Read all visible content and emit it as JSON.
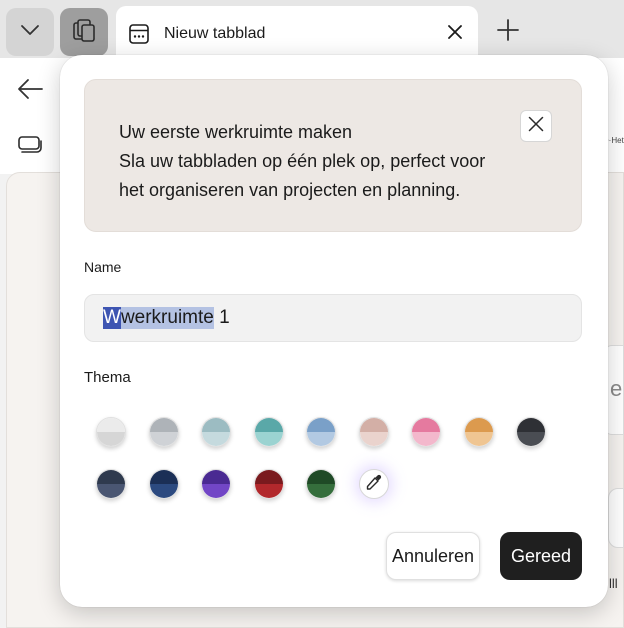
{
  "browser": {
    "tab": {
      "title": "Nieuw tabblad",
      "icon": "new-tab-page-icon"
    },
    "background_fragment": "~·Het",
    "background_char": "e",
    "background_bars": "lll"
  },
  "dialog": {
    "banner": {
      "title": "Uw eerste werkruimte maken",
      "line2": "Sla uw tabbladen op één plek op, perfect voor",
      "line3": "het organiseren van projecten en planning."
    },
    "name_label": "Name",
    "name_value": {
      "part_a": "W",
      "part_b": "werkruimte",
      "part_c": " 1"
    },
    "theme_label": "Thema",
    "themes": [
      {
        "name": "light-gray",
        "top": "#ebebeb",
        "bottom": "#d6d6d6"
      },
      {
        "name": "gray",
        "top": "#aeb3b8",
        "bottom": "#cfd2d6"
      },
      {
        "name": "blue-gray",
        "top": "#9cbcc2",
        "bottom": "#c5dade"
      },
      {
        "name": "teal",
        "top": "#5aa8a8",
        "bottom": "#9bd3d1"
      },
      {
        "name": "light-blue",
        "top": "#7aa0c8",
        "bottom": "#b2c9e2"
      },
      {
        "name": "rose",
        "top": "#d3afa6",
        "bottom": "#ead3cd"
      },
      {
        "name": "pink",
        "top": "#e57a9f",
        "bottom": "#f3b8cc"
      },
      {
        "name": "orange",
        "top": "#dc9a4e",
        "bottom": "#efc592"
      },
      {
        "name": "charcoal",
        "top": "#2e3035",
        "bottom": "#4a4d53"
      },
      {
        "name": "slate",
        "top": "#2f3a4e",
        "bottom": "#4a5672"
      },
      {
        "name": "navy",
        "top": "#1b2f56",
        "bottom": "#2c4a80"
      },
      {
        "name": "purple",
        "top": "#4a2a92",
        "bottom": "#7246c6"
      },
      {
        "name": "red",
        "top": "#7a1a1e",
        "bottom": "#b2282c"
      },
      {
        "name": "green",
        "top": "#1f4a26",
        "bottom": "#356e3c"
      }
    ],
    "color_picker_icon": "eyedropper-icon",
    "cancel_label": "Annuleren",
    "done_label": "Gereed"
  }
}
